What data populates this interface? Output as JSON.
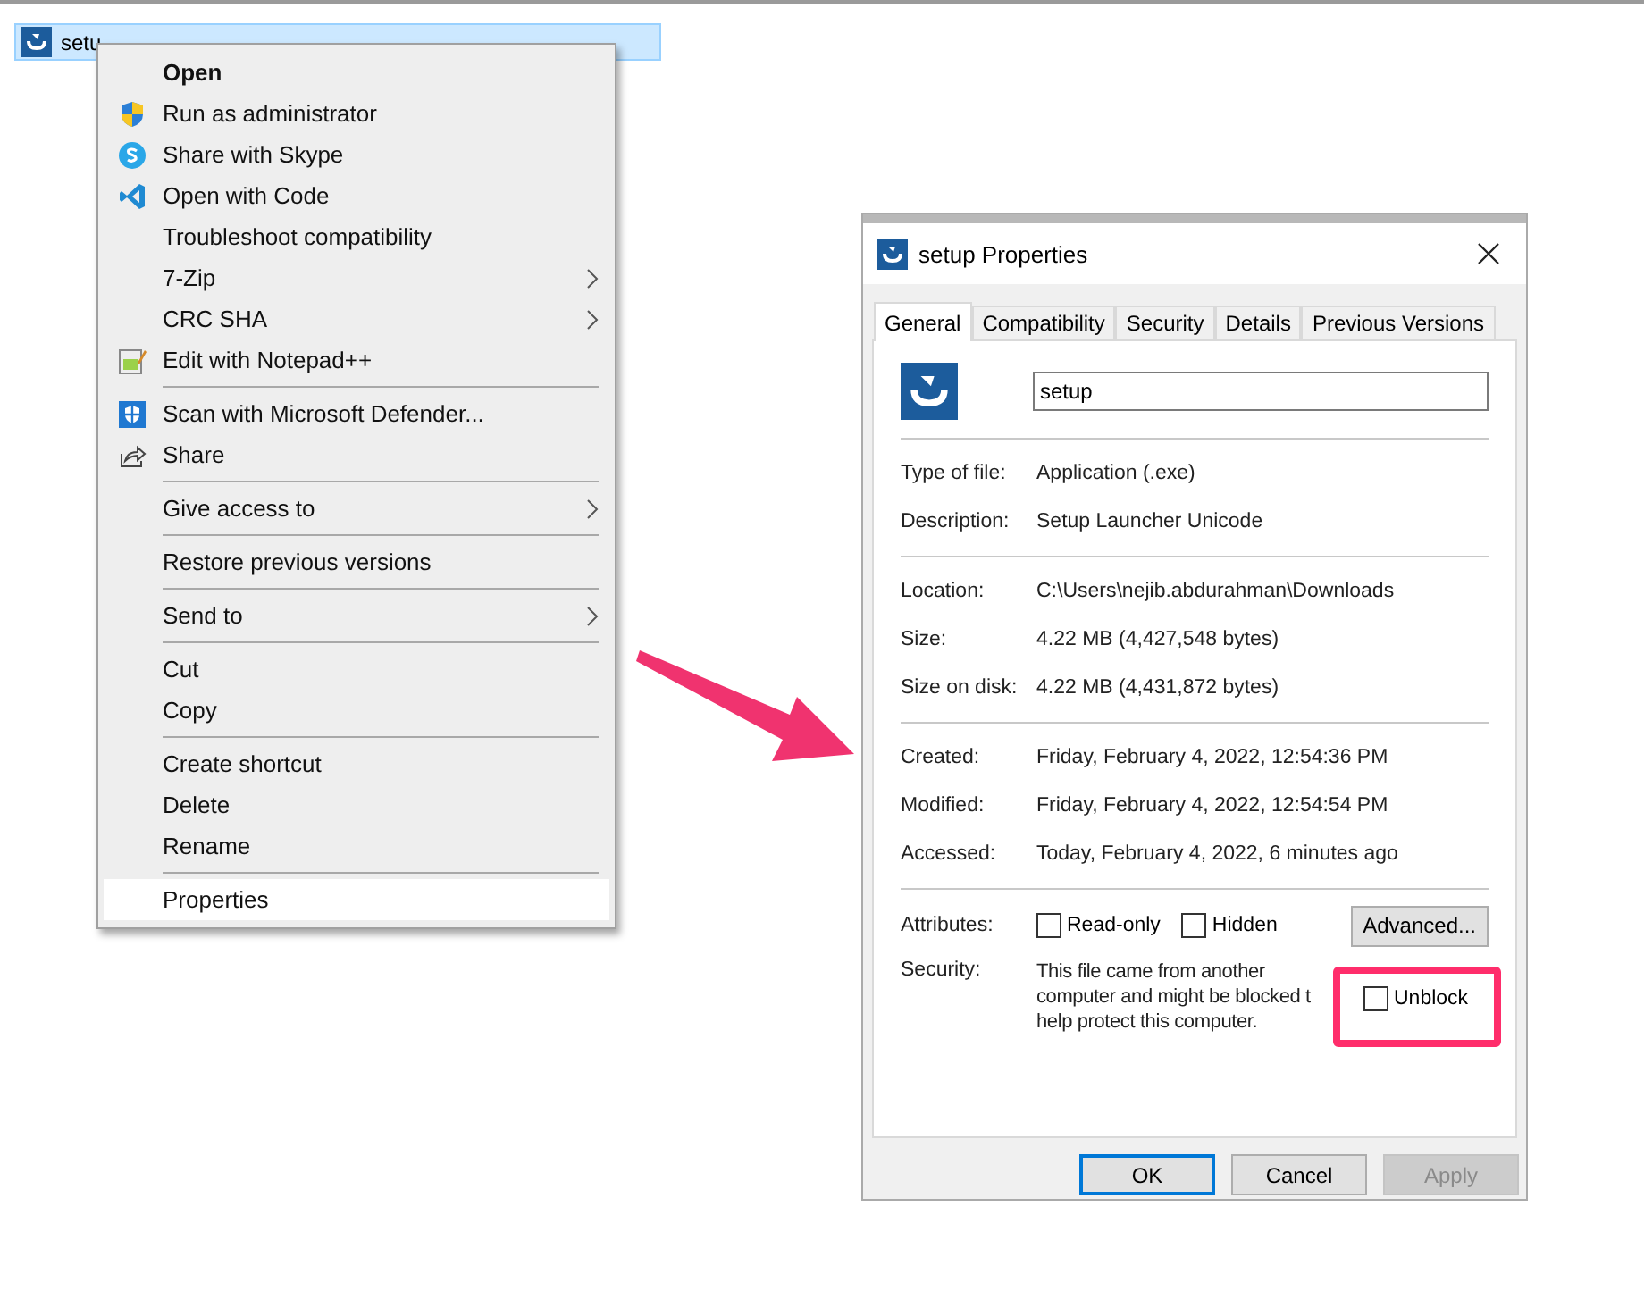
{
  "file_row": {
    "name": "setu",
    "selected": true
  },
  "context_menu": {
    "items": [
      {
        "kind": "item",
        "label": "Open",
        "default": true,
        "submenu": false,
        "selected": false
      },
      {
        "kind": "item",
        "label": "Run as administrator",
        "default": false,
        "submenu": false,
        "selected": false
      },
      {
        "kind": "item",
        "label": "Share with Skype",
        "default": false,
        "submenu": false,
        "selected": false
      },
      {
        "kind": "item",
        "label": "Open with Code",
        "default": false,
        "submenu": false,
        "selected": false
      },
      {
        "kind": "item",
        "label": "Troubleshoot compatibility",
        "default": false,
        "submenu": false,
        "selected": false
      },
      {
        "kind": "item",
        "label": "7-Zip",
        "default": false,
        "submenu": true,
        "selected": false
      },
      {
        "kind": "item",
        "label": "CRC SHA",
        "default": false,
        "submenu": true,
        "selected": false
      },
      {
        "kind": "item",
        "label": "Edit with Notepad++",
        "default": false,
        "submenu": false,
        "selected": false
      },
      {
        "kind": "separator"
      },
      {
        "kind": "item",
        "label": "Scan with Microsoft Defender...",
        "default": false,
        "submenu": false,
        "selected": false
      },
      {
        "kind": "item",
        "label": "Share",
        "default": false,
        "submenu": false,
        "selected": false
      },
      {
        "kind": "separator"
      },
      {
        "kind": "item",
        "label": "Give access to",
        "default": false,
        "submenu": true,
        "selected": false
      },
      {
        "kind": "separator"
      },
      {
        "kind": "item",
        "label": "Restore previous versions",
        "default": false,
        "submenu": false,
        "selected": false
      },
      {
        "kind": "separator"
      },
      {
        "kind": "item",
        "label": "Send to",
        "default": false,
        "submenu": true,
        "selected": false
      },
      {
        "kind": "separator"
      },
      {
        "kind": "item",
        "label": "Cut",
        "default": false,
        "submenu": false,
        "selected": false
      },
      {
        "kind": "item",
        "label": "Copy",
        "default": false,
        "submenu": false,
        "selected": false
      },
      {
        "kind": "separator"
      },
      {
        "kind": "item",
        "label": "Create shortcut",
        "default": false,
        "submenu": false,
        "selected": false
      },
      {
        "kind": "item",
        "label": "Delete",
        "default": false,
        "submenu": false,
        "selected": false
      },
      {
        "kind": "item",
        "label": "Rename",
        "default": false,
        "submenu": false,
        "selected": false
      },
      {
        "kind": "separator"
      },
      {
        "kind": "item",
        "label": "Properties",
        "default": false,
        "submenu": false,
        "selected": true
      }
    ]
  },
  "dialog": {
    "title": "setup Properties",
    "tabs": [
      {
        "label": "General",
        "selected": true
      },
      {
        "label": "Compatibility",
        "selected": false
      },
      {
        "label": "Security",
        "selected": false
      },
      {
        "label": "Details",
        "selected": false
      },
      {
        "label": "Previous Versions",
        "selected": false
      }
    ],
    "name_value": "setup",
    "groups": [
      [
        {
          "label": "Type of file:",
          "value": "Application (.exe)"
        },
        {
          "label": "Description:",
          "value": "Setup Launcher Unicode"
        }
      ],
      [
        {
          "label": "Location:",
          "value": "C:\\Users\\nejib.abdurahman\\Downloads"
        },
        {
          "label": "Size:",
          "value": "4.22 MB (4,427,548 bytes)"
        },
        {
          "label": "Size on disk:",
          "value": "4.22 MB (4,431,872 bytes)"
        }
      ],
      [
        {
          "label": "Created:",
          "value": "Friday, February 4, 2022, 12:54:36 PM"
        },
        {
          "label": "Modified:",
          "value": "Friday, February 4, 2022, 12:54:54 PM"
        },
        {
          "label": "Accessed:",
          "value": "Today, February 4, 2022, 6 minutes ago"
        }
      ]
    ],
    "attributes_label": "Attributes:",
    "attributes": [
      {
        "label": "Read-only",
        "checked": false
      },
      {
        "label": "Hidden",
        "checked": false
      }
    ],
    "advanced_button": "Advanced...",
    "security_label": "Security:",
    "security_lines": [
      "This file came from another",
      "computer and might be blocked t",
      "help protect this computer."
    ],
    "unblock": {
      "label": "Unblock",
      "checked": false,
      "highlighted": true
    },
    "buttons": [
      {
        "label": "OK",
        "default": true,
        "disabled": false
      },
      {
        "label": "Cancel",
        "default": false,
        "disabled": false
      },
      {
        "label": "Apply",
        "default": false,
        "disabled": true
      }
    ]
  }
}
